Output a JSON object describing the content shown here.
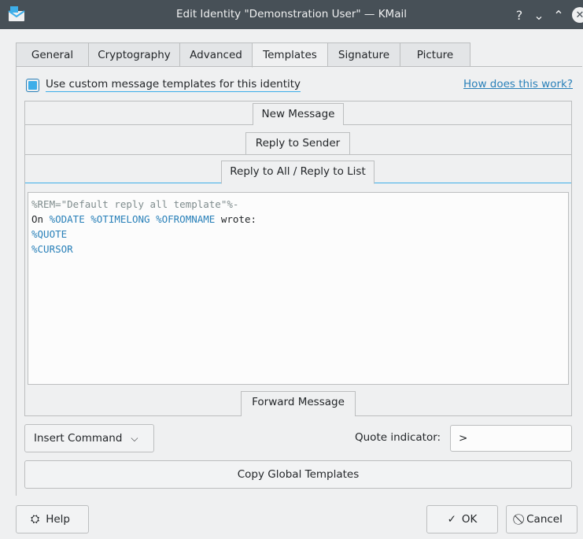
{
  "window": {
    "title": "Edit Identity \"Demonstration User\" — KMail",
    "controls": {
      "help": "?",
      "minimize": "⌄",
      "maximize": "⌃",
      "close": "✕"
    }
  },
  "tabs": [
    {
      "label": "General"
    },
    {
      "label": "Cryptography"
    },
    {
      "label": "Advanced"
    },
    {
      "label": "Templates"
    },
    {
      "label": "Signature"
    },
    {
      "label": "Picture"
    }
  ],
  "active_tab": "Templates",
  "custom_templates": {
    "label": "Use custom message templates for this identity",
    "checked": true
  },
  "help_link": "How does this work?",
  "sections": {
    "new_message": "New Message",
    "reply_sender": "Reply to Sender",
    "reply_all": "Reply to All / Reply to List",
    "forward": "Forward Message"
  },
  "editor": {
    "lines": [
      [
        {
          "text": "%REM=\"Default reply all template\"%-",
          "color": "grey"
        }
      ],
      [
        {
          "text": "On ",
          "color": "dark"
        },
        {
          "text": "%ODATE",
          "color": "blue"
        },
        {
          "text": " ",
          "color": "dark"
        },
        {
          "text": "%OTIMELONG",
          "color": "blue"
        },
        {
          "text": " ",
          "color": "dark"
        },
        {
          "text": "%OFROMNAME",
          "color": "blue"
        },
        {
          "text": " wrote:",
          "color": "dark"
        }
      ],
      [
        {
          "text": "%QUOTE",
          "color": "blue"
        }
      ],
      [
        {
          "text": "%CURSOR",
          "color": "blue"
        }
      ]
    ]
  },
  "insert_command": {
    "label": "Insert Command"
  },
  "quote_indicator": {
    "label": "Quote indicator:",
    "value": ">"
  },
  "copy_global": {
    "label": "Copy Global Templates"
  },
  "footer": {
    "help": "Help",
    "ok": "OK",
    "cancel": "Cancel"
  },
  "colors": {
    "accent": "#3daee9",
    "link": "#2980b9",
    "titlebar": "#475057"
  }
}
